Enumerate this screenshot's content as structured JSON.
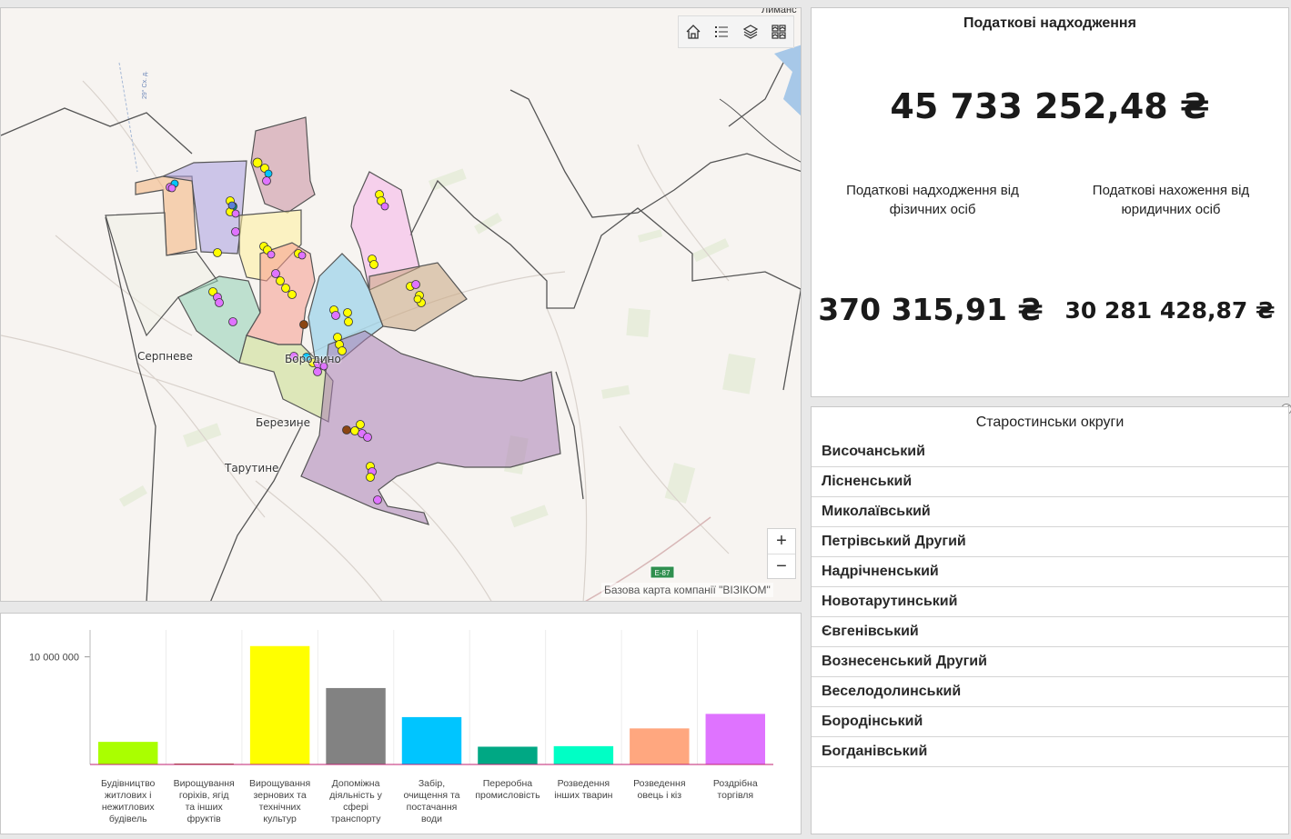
{
  "map": {
    "toolbar": [
      {
        "name": "home-icon",
        "glyph": "⌂"
      },
      {
        "name": "legend-list-icon",
        "glyph": "☰"
      },
      {
        "name": "layers-icon",
        "glyph": "◈"
      },
      {
        "name": "basemap-gallery-icon",
        "glyph": "▦"
      }
    ],
    "zoom_in": "+",
    "zoom_out": "−",
    "attribution": "Базова карта компанії \"ВІЗІКОМ\"",
    "road_badge": "E-87",
    "top_label": "Лиманс",
    "road_label": "29° Сх. д.",
    "place_labels": {
      "serpneve": "Серпневе",
      "borodino": "Бородино",
      "berezyne": "Березине",
      "tarutyne": "Тарутине"
    }
  },
  "tax": {
    "title": "Податкові надходження",
    "total": "45 733 252,48 ₴",
    "individuals_label": "Податкові надходження від фізичних осіб",
    "individuals_value": "370 315,91 ₴",
    "legal_label": "Податкові нахоження від юридичних осіб",
    "legal_value": "30 281 428,87 ₴"
  },
  "districts": {
    "title": "Старостинськи округи",
    "items": [
      "Височанський",
      "Лісненський",
      "Миколаївський",
      "Петрівський Другий",
      "Надрічненський",
      "Новотарутинський",
      "Євгенівський",
      "Вознесенський Другий",
      "Веселодолинський",
      "Бородінський",
      "Богданівський"
    ]
  },
  "chart_data": {
    "type": "bar",
    "ytick_label": "10 000 000",
    "ytick_value": 10000000,
    "ylim": [
      0,
      12500000
    ],
    "categories": [
      "Будівництво житлових і нежитлових будівель",
      "Вирощування горіхів, ягід та інших фруктів",
      "Вирощування зернових та технічних культур",
      "Допоміжна діяльність у сфері транспорту",
      "Забір, очищення та постачання води",
      "Переробна промисловість",
      "Розведення інших тварин",
      "Розведення овець і кіз",
      "Роздрібна торгівля"
    ],
    "category_lines": [
      [
        "Будівництво",
        "житлових і",
        "нежитлових",
        "будівель"
      ],
      [
        "Вирощування",
        "горіхів, ягід",
        "та інших",
        "фруктів"
      ],
      [
        "Вирощування",
        "зернових та",
        "технічних",
        "культур"
      ],
      [
        "Допоміжна",
        "діяльність у",
        "сфері",
        "транспорту"
      ],
      [
        "Забір,",
        "очищення та",
        "постачання",
        "води"
      ],
      [
        "Переробна",
        "промисловість"
      ],
      [
        "Розведення",
        "інших тварин"
      ],
      [
        "Розведення",
        "овець і кіз"
      ],
      [
        "Роздрібна",
        "торгівля"
      ]
    ],
    "values": [
      2100000,
      80000,
      11000000,
      7100000,
      4400000,
      1650000,
      1700000,
      3350000,
      4700000
    ],
    "colors": [
      "#aaff00",
      "#8b4513",
      "#ffff00",
      "#828282",
      "#00c5ff",
      "#00a884",
      "#00ffc5",
      "#ffa77f",
      "#df73ff"
    ]
  }
}
